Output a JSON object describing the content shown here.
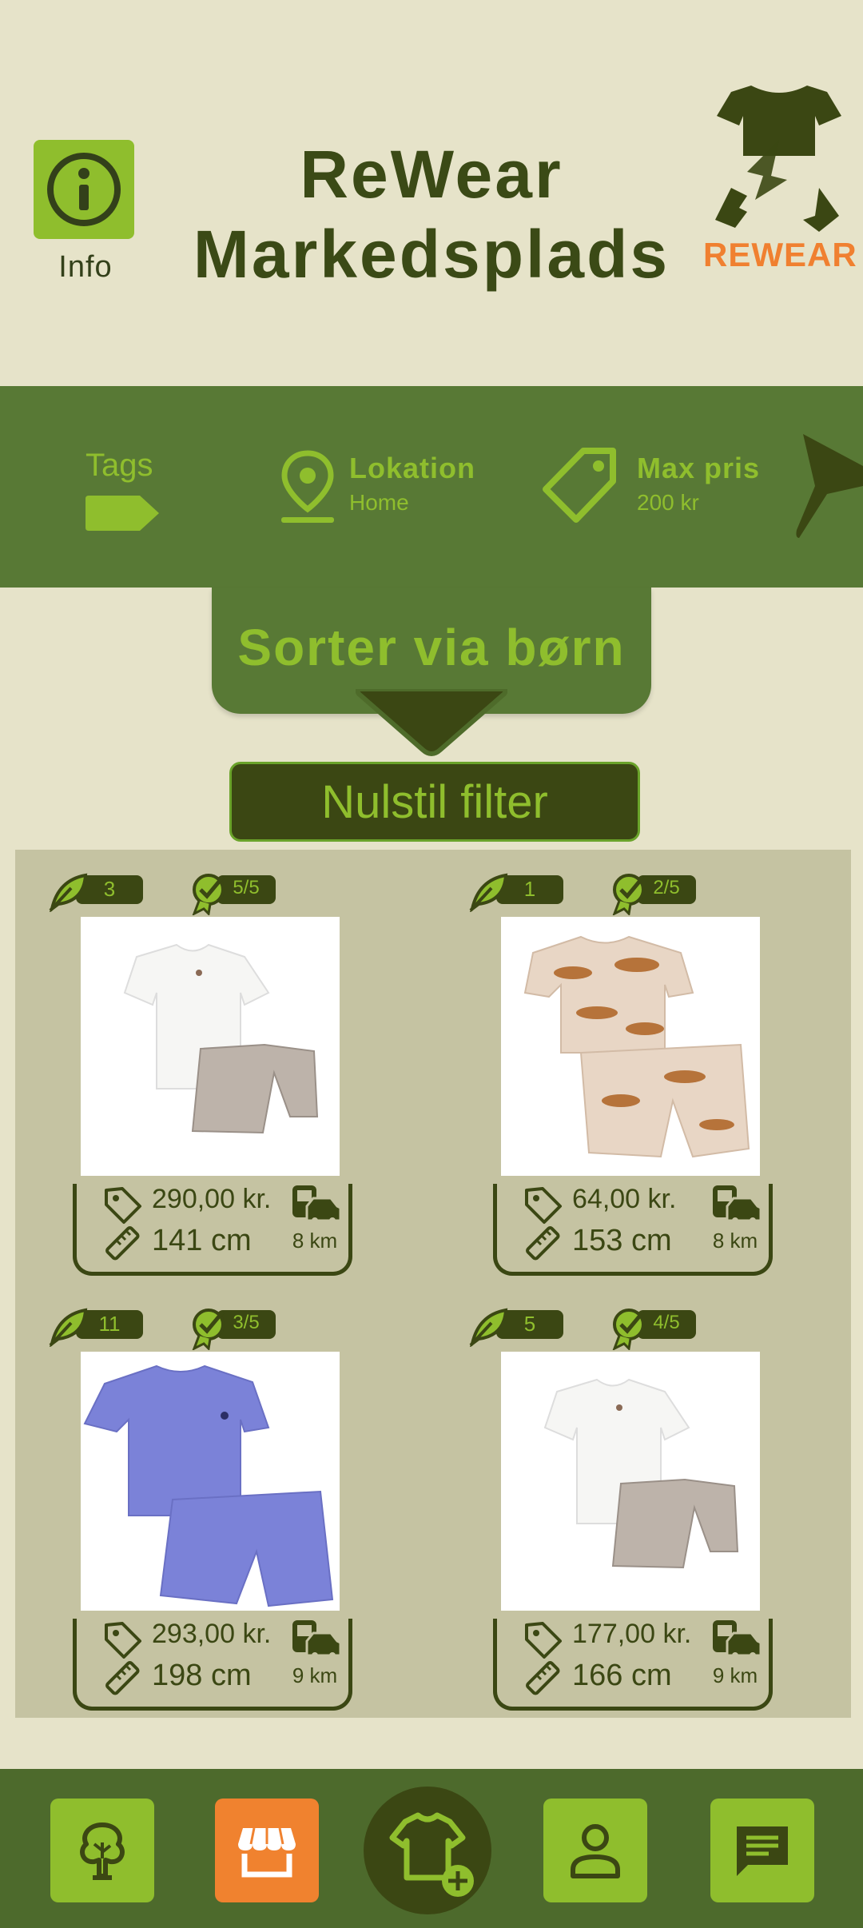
{
  "header": {
    "info_label": "Info",
    "title_line1": "ReWear",
    "title_line2": "Markedsplads",
    "logo_text": "REWEAR"
  },
  "filters": {
    "tags_label": "Tags",
    "location_title": "Lokation",
    "location_value": "Home",
    "price_title": "Max pris",
    "price_value": "200 kr"
  },
  "sort_label": "Sorter via børn",
  "reset_label": "Nulstil filter",
  "products": [
    {
      "leaf": "3",
      "rating": "5/5",
      "price": "290,00 kr.",
      "size": "141 cm",
      "distance": "8 km",
      "photo": "white-tshirt-striped-shorts"
    },
    {
      "leaf": "1",
      "rating": "2/5",
      "price": "64,00 kr.",
      "size": "153 cm",
      "distance": "8 km",
      "photo": "beige-leopard-set"
    },
    {
      "leaf": "11",
      "rating": "3/5",
      "price": "293,00 kr.",
      "size": "198 cm",
      "distance": "9 km",
      "photo": "blue-striped-set"
    },
    {
      "leaf": "5",
      "rating": "4/5",
      "price": "177,00 kr.",
      "size": "166 cm",
      "distance": "9 km",
      "photo": "white-tshirt-striped-shorts"
    }
  ],
  "nav": {
    "items": [
      "tree-icon",
      "shop-icon",
      "add-clothing-icon",
      "profile-icon",
      "chat-icon"
    ],
    "active": "shop-icon"
  },
  "colors": {
    "accent_green": "#8fbe2d",
    "dark_green": "#3b4713",
    "mid_green": "#587935",
    "orange": "#f0822f",
    "background": "#e6e3c9"
  }
}
